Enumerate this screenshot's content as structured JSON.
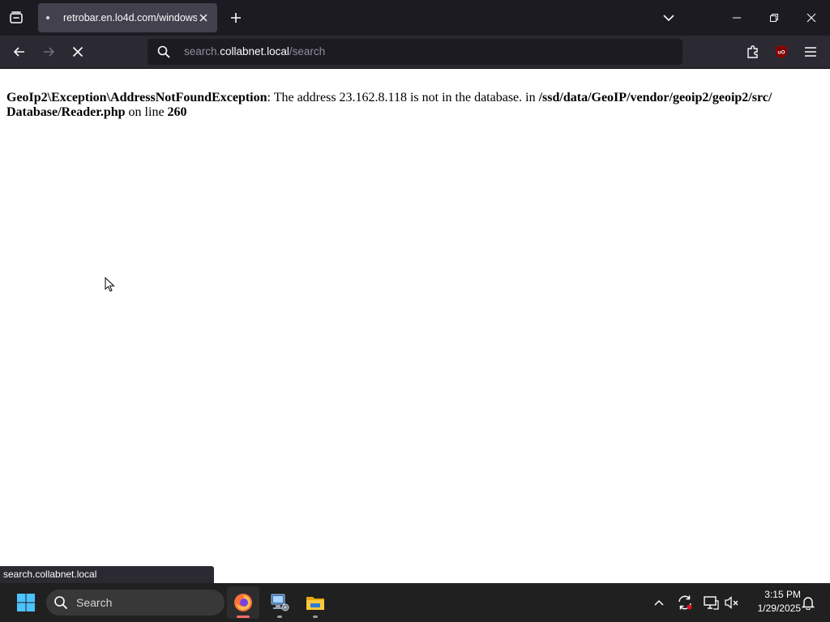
{
  "browser": {
    "tab": {
      "title": "retrobar.en.lo4d.com/windows"
    },
    "urlbar": {
      "host_prefix": "search.",
      "domain": "collabnet.local",
      "path": "/search"
    },
    "status_text": "search.collabnet.local",
    "extension_badge": "uO"
  },
  "page": {
    "error": {
      "exception": "GeoIp2\\Exception\\AddressNotFoundException",
      "message": ": The address 23.162.8.118 is not in the database. in ",
      "file": "/ssd/data/GeoIP/vendor/geoip2/geoip2/src/ Database/Reader.php",
      "line_label": " on line ",
      "line_number": "260"
    }
  },
  "taskbar": {
    "search_label": "Search",
    "clock": {
      "time": "3:15 PM",
      "date": "1/29/2025"
    },
    "apps": [
      "firefox-icon",
      "network-computer-icon",
      "file-explorer-icon"
    ]
  },
  "colors": {
    "tabstrip_bg": "#1c1b22",
    "navbar_bg": "#2b2a33",
    "active_tab_bg": "#42414d",
    "taskbar_bg": "#202020",
    "firefox_indicator": "#ff6b6b"
  }
}
